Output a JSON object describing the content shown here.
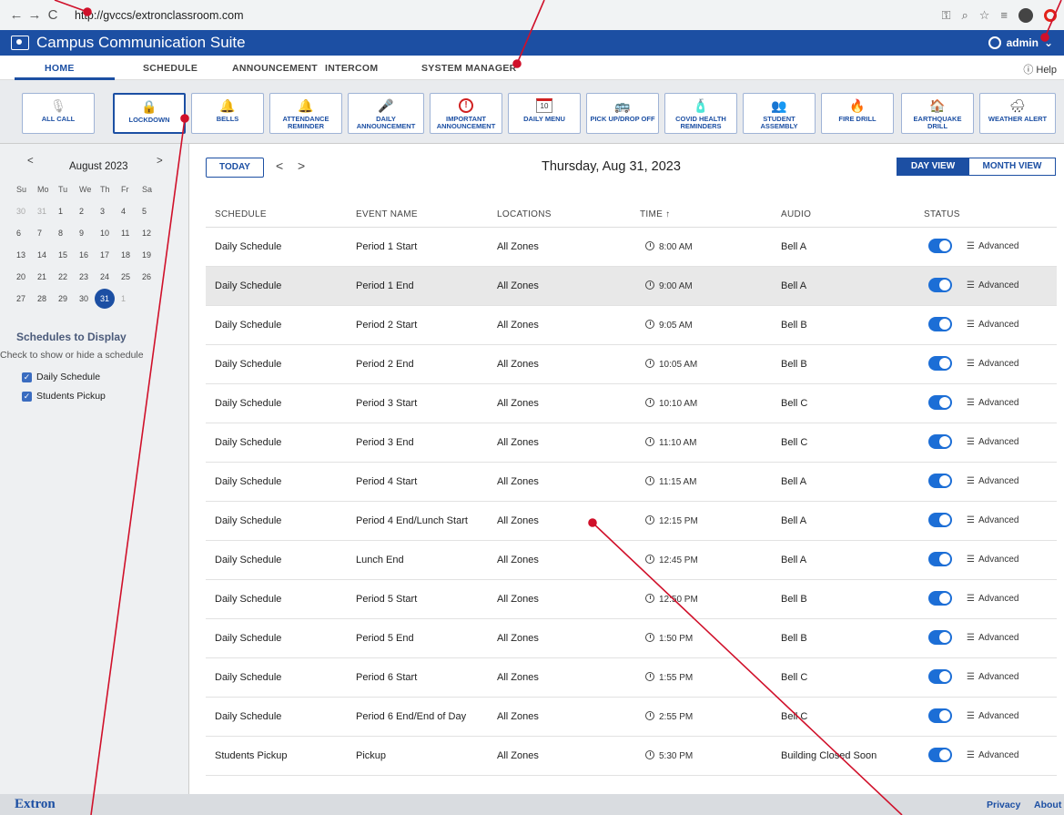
{
  "browser": {
    "url": "http://gvccs/extronclassroom.com",
    "back_icon": "←",
    "forward_icon": "→",
    "reload_icon": "C"
  },
  "app": {
    "title": "Campus Communication Suite",
    "user": "admin",
    "help": "Help",
    "accent": "#1c4fa3"
  },
  "nav": {
    "tabs": [
      "HOME",
      "SCHEDULE",
      "ANNOUNCEMENT",
      "INTERCOM",
      "SYSTEM MANAGER"
    ]
  },
  "quick_buttons": [
    {
      "label": "ALL CALL",
      "icon": "🎙"
    },
    {
      "label": "LOCKDOWN",
      "icon": "🔒"
    },
    {
      "label": "BELLS",
      "icon": "🔔"
    },
    {
      "label": "ATTENDANCE REMINDER",
      "icon": "🔔"
    },
    {
      "label": "DAILY ANNOUNCEMENT",
      "icon": "🎤"
    },
    {
      "label": "IMPORTANT ANNOUNCEMENT",
      "icon": "!"
    },
    {
      "label": "DAILY MENU",
      "icon": "10"
    },
    {
      "label": "PICK UP/DROP OFF",
      "icon": "🚌"
    },
    {
      "label": "COVID HEALTH REMINDERS",
      "icon": "🧴"
    },
    {
      "label": "STUDENT ASSEMBLY",
      "icon": "👥"
    },
    {
      "label": "FIRE DRILL",
      "icon": "🔥"
    },
    {
      "label": "EARTHQUAKE DRILL",
      "icon": "🏠"
    },
    {
      "label": "WEATHER ALERT",
      "icon": "🌧"
    }
  ],
  "calendar": {
    "month": "August 2023",
    "prev": "<",
    "next": ">",
    "dows": [
      "Su",
      "Mo",
      "Tu",
      "We",
      "Th",
      "Fr",
      "Sa"
    ],
    "weeks": [
      [
        "30",
        "31",
        "1",
        "2",
        "3",
        "4",
        "5"
      ],
      [
        "6",
        "7",
        "8",
        "9",
        "10",
        "11",
        "12"
      ],
      [
        "13",
        "14",
        "15",
        "16",
        "17",
        "18",
        "19"
      ],
      [
        "20",
        "21",
        "22",
        "23",
        "24",
        "25",
        "26"
      ],
      [
        "27",
        "28",
        "29",
        "30",
        "31",
        "1",
        ""
      ]
    ],
    "selected": "31"
  },
  "schedules": {
    "title": "Schedules to Display",
    "subtitle": "Check to show or hide a schedule",
    "items": [
      "Daily Schedule",
      "Students Pickup"
    ]
  },
  "toolbar": {
    "today": "TODAY",
    "prev": "<",
    "next": ">",
    "date": "Thursday, Aug 31, 2023",
    "day_view": "DAY VIEW",
    "month_view": "MONTH VIEW"
  },
  "table": {
    "headers": [
      "SCHEDULE",
      "EVENT NAME",
      "LOCATIONS",
      "TIME ↑",
      "AUDIO",
      "STATUS"
    ],
    "advanced_label": "Advanced",
    "rows": [
      {
        "schedule": "Daily Schedule",
        "event": "Period 1 Start",
        "location": "All Zones",
        "time": "8:00 AM",
        "audio": "Bell A",
        "status": "on"
      },
      {
        "schedule": "Daily Schedule",
        "event": "Period 1 End",
        "location": "All Zones",
        "time": "9:00 AM",
        "audio": "Bell A",
        "status": "on"
      },
      {
        "schedule": "Daily Schedule",
        "event": "Period 2 Start",
        "location": "All Zones",
        "time": "9:05 AM",
        "audio": "Bell B",
        "status": "on"
      },
      {
        "schedule": "Daily Schedule",
        "event": "Period 2 End",
        "location": "All Zones",
        "time": "10:05 AM",
        "audio": "Bell B",
        "status": "on"
      },
      {
        "schedule": "Daily Schedule",
        "event": "Period 3 Start",
        "location": "All Zones",
        "time": "10:10 AM",
        "audio": "Bell C",
        "status": "on"
      },
      {
        "schedule": "Daily Schedule",
        "event": "Period 3 End",
        "location": "All Zones",
        "time": "11:10 AM",
        "audio": "Bell C",
        "status": "on"
      },
      {
        "schedule": "Daily Schedule",
        "event": "Period 4 Start",
        "location": "All Zones",
        "time": "11:15 AM",
        "audio": "Bell A",
        "status": "on"
      },
      {
        "schedule": "Daily Schedule",
        "event": "Period 4 End/Lunch Start",
        "location": "All Zones",
        "time": "12:15 PM",
        "audio": "Bell A",
        "status": "on"
      },
      {
        "schedule": "Daily Schedule",
        "event": "Lunch End",
        "location": "All Zones",
        "time": "12:45 PM",
        "audio": "Bell A",
        "status": "on"
      },
      {
        "schedule": "Daily Schedule",
        "event": "Period 5 Start",
        "location": "All Zones",
        "time": "12:50 PM",
        "audio": "Bell B",
        "status": "on"
      },
      {
        "schedule": "Daily Schedule",
        "event": "Period 5 End",
        "location": "All Zones",
        "time": "1:50 PM",
        "audio": "Bell B",
        "status": "on"
      },
      {
        "schedule": "Daily Schedule",
        "event": "Period 6 Start",
        "location": "All Zones",
        "time": "1:55 PM",
        "audio": "Bell C",
        "status": "on"
      },
      {
        "schedule": "Daily Schedule",
        "event": "Period 6 End/End of Day",
        "location": "All Zones",
        "time": "2:55 PM",
        "audio": "Bell C",
        "status": "on"
      },
      {
        "schedule": "Students Pickup",
        "event": "Pickup",
        "location": "All Zones",
        "time": "5:30 PM",
        "audio": "Building Closed Soon",
        "status": "on"
      }
    ]
  },
  "footer": {
    "brand": "Extron",
    "links": [
      "Privacy",
      "About"
    ]
  }
}
